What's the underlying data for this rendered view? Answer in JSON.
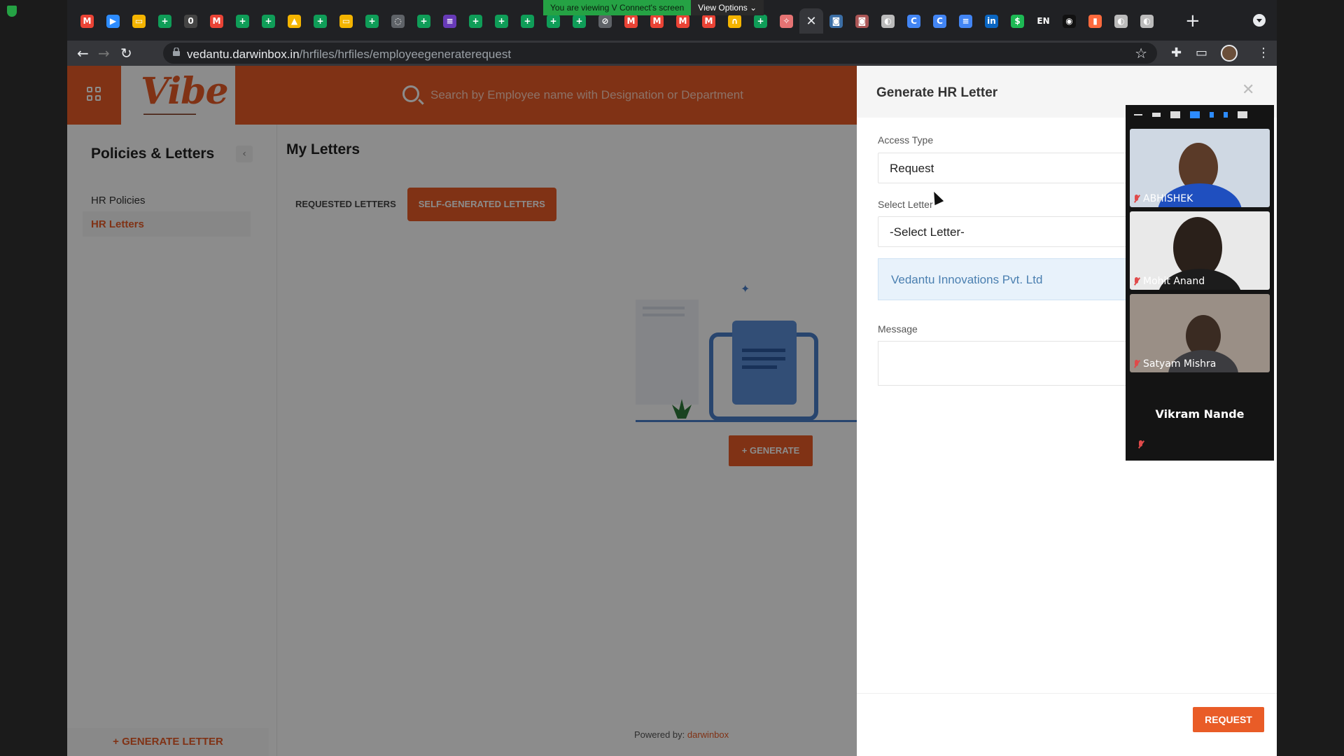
{
  "share_banner": {
    "viewing": "You are viewing V Connect's screen",
    "options": "View Options ⌄"
  },
  "browser": {
    "url_host": "vedantu.darwinbox.in",
    "url_path": "/hrfiles/hrfiles/employeegeneraterequest",
    "tab_favicons": [
      {
        "name": "gmail",
        "glyph": "M",
        "color": "#ea4335"
      },
      {
        "name": "meet",
        "glyph": "▶",
        "color": "#2d8cff"
      },
      {
        "name": "slides",
        "glyph": "▭",
        "color": "#f4b400"
      },
      {
        "name": "sheets",
        "glyph": "+",
        "color": "#0f9d58"
      },
      {
        "name": "app",
        "glyph": "0",
        "color": "#444"
      },
      {
        "name": "gmail",
        "glyph": "M",
        "color": "#ea4335"
      },
      {
        "name": "sheets",
        "glyph": "+",
        "color": "#0f9d58"
      },
      {
        "name": "sheets",
        "glyph": "+",
        "color": "#0f9d58"
      },
      {
        "name": "drive",
        "glyph": "▲",
        "color": "#f4b400"
      },
      {
        "name": "sheets",
        "glyph": "+",
        "color": "#0f9d58"
      },
      {
        "name": "slides",
        "glyph": "▭",
        "color": "#f4b400"
      },
      {
        "name": "sheets",
        "glyph": "+",
        "color": "#0f9d58"
      },
      {
        "name": "web",
        "glyph": "◌",
        "color": "#5f6368"
      },
      {
        "name": "sheets",
        "glyph": "+",
        "color": "#0f9d58"
      },
      {
        "name": "forms",
        "glyph": "≡",
        "color": "#673ab7"
      },
      {
        "name": "sheets",
        "glyph": "+",
        "color": "#0f9d58"
      },
      {
        "name": "sheets",
        "glyph": "+",
        "color": "#0f9d58"
      },
      {
        "name": "sheets",
        "glyph": "+",
        "color": "#0f9d58"
      },
      {
        "name": "sheets",
        "glyph": "+",
        "color": "#0f9d58"
      },
      {
        "name": "sheets",
        "glyph": "+",
        "color": "#0f9d58"
      },
      {
        "name": "web",
        "glyph": "⊘",
        "color": "#5f6368"
      },
      {
        "name": "gmail",
        "glyph": "M",
        "color": "#ea4335"
      },
      {
        "name": "gmail",
        "glyph": "M",
        "color": "#ea4335"
      },
      {
        "name": "gmail",
        "glyph": "M",
        "color": "#ea4335"
      },
      {
        "name": "gmail",
        "glyph": "M",
        "color": "#ea4335"
      },
      {
        "name": "web",
        "glyph": "∩",
        "color": "#f4b400"
      },
      {
        "name": "sheets",
        "glyph": "+",
        "color": "#0f9d58"
      },
      {
        "name": "web",
        "glyph": "✧",
        "color": "#e57373"
      }
    ],
    "tab_favicons_after": [
      {
        "name": "web",
        "glyph": "◙",
        "color": "#3b6ea5"
      },
      {
        "name": "web",
        "glyph": "◙",
        "color": "#a55"
      },
      {
        "name": "web",
        "glyph": "◐",
        "color": "#bbb"
      },
      {
        "name": "chrome",
        "glyph": "C",
        "color": "#4285f4"
      },
      {
        "name": "chrome",
        "glyph": "C",
        "color": "#4285f4"
      },
      {
        "name": "docs",
        "glyph": "≡",
        "color": "#4285f4"
      },
      {
        "name": "linkedin",
        "glyph": "in",
        "color": "#0a66c2"
      },
      {
        "name": "web",
        "glyph": "$",
        "color": "#1db954"
      },
      {
        "name": "lang",
        "glyph": "EN",
        "color": "#202124"
      },
      {
        "name": "web",
        "glyph": "◉",
        "color": "#111"
      },
      {
        "name": "web",
        "glyph": "▮",
        "color": "#ff6a3d"
      },
      {
        "name": "web",
        "glyph": "◐",
        "color": "#bbb"
      },
      {
        "name": "web",
        "glyph": "◐",
        "color": "#bbb"
      }
    ]
  },
  "app": {
    "search_placeholder": "Search by Employee name with Designation or Department",
    "logo_word": "Vibe",
    "sidebar": {
      "title": "Policies & Letters",
      "items": [
        {
          "label": "HR Policies"
        },
        {
          "label": "HR Letters"
        }
      ],
      "generate_letter": "+ GENERATE LETTER"
    },
    "main": {
      "title": "My Letters",
      "tabs": [
        {
          "label": "REQUESTED LETTERS"
        },
        {
          "label": "SELF-GENERATED LETTERS"
        }
      ],
      "generate_button": "+ GENERATE",
      "powered_by": "Powered by: ",
      "powered_brand": "darwinbox"
    }
  },
  "drawer": {
    "title": "Generate HR Letter",
    "access_type_label": "Access Type",
    "access_type_value": "Request",
    "select_letter_label": "Select Letter",
    "select_letter_value": "-Select Letter-",
    "company": "Vedantu Innovations Pvt. Ltd",
    "message_label": "Message",
    "request_button": "REQUEST"
  },
  "video_call": {
    "participants": [
      {
        "name": "ABHISHEK"
      },
      {
        "name": "Mohit Anand"
      },
      {
        "name": "Satyam Mishra"
      },
      {
        "name": "Vikram Nande"
      }
    ]
  },
  "colors": {
    "brand": "#e95c27",
    "link": "#4a7fb0"
  }
}
